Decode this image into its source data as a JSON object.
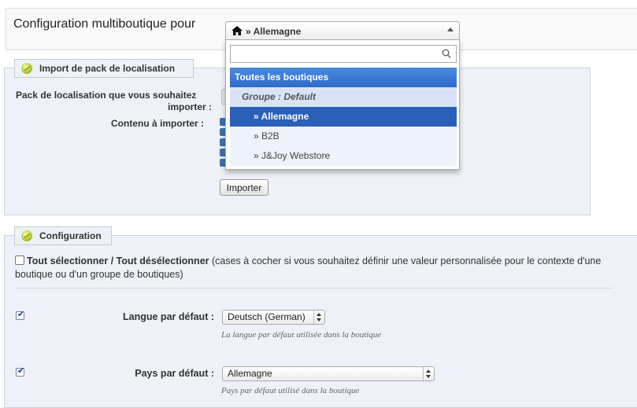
{
  "header": {
    "title": "Configuration multiboutique pour"
  },
  "shop_selector": {
    "selected": "» Allemagne",
    "search_placeholder": "",
    "options": [
      {
        "label": "Toutes les boutiques"
      },
      {
        "label": "Groupe : Default"
      },
      {
        "label": "» Allemagne"
      },
      {
        "label": "» B2B"
      },
      {
        "label": "» J&Joy Webstore"
      }
    ]
  },
  "import_section": {
    "legend": "Import de pack de localisation",
    "pack_label_line1": "Pack de localisation que vous souhaitez",
    "pack_label_line2": "importer :",
    "content_label": "Contenu à importer :",
    "import_button": "Importer"
  },
  "config_section": {
    "legend": "Configuration",
    "select_all_bold": "Tout sélectionner / Tout désélectionner",
    "select_all_rest": " (cases à cocher si vous souhaitez définir une valeur personnalisée pour le contexte d'une boutique ou d'un groupe de boutiques)",
    "fields": [
      {
        "label": "Langue par défaut :",
        "value": "Deutsch (German)",
        "hint": "La langue par défaut utilisée dans la boutique",
        "checked": true
      },
      {
        "label": "Pays par défaut :",
        "value": "Allemagne",
        "hint": "Pays par défaut utilisé dans la boutique",
        "checked": true
      }
    ]
  },
  "colors": {
    "highlight": "#3875d7",
    "selected": "#2c5fb8",
    "panel": "#eef1f7"
  }
}
